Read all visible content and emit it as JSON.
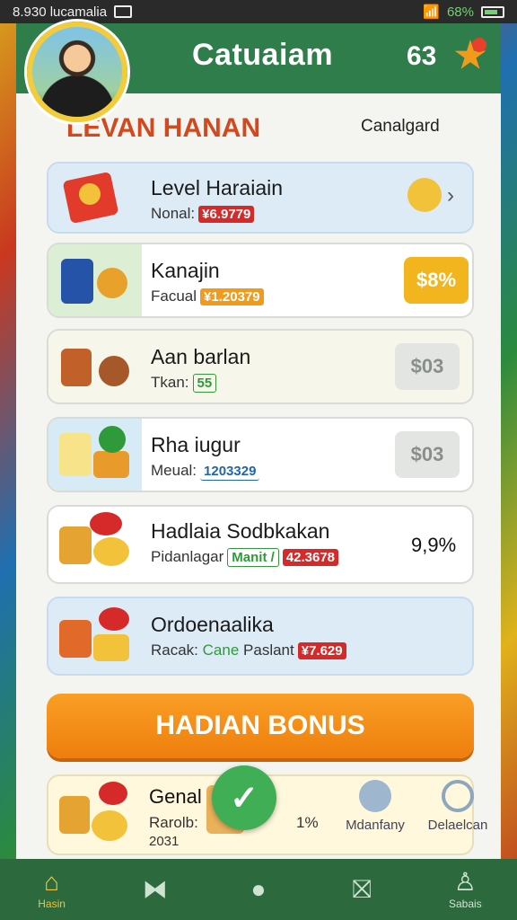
{
  "status_bar": {
    "time_text": "8.930 lucamalia",
    "battery": "68%"
  },
  "header": {
    "title": "Catuaiam",
    "count": "63"
  },
  "section": {
    "title": "LEVAN HANAN",
    "link": "Canalgard"
  },
  "items": [
    {
      "title": "Level Haraiain",
      "sub_label": "Nonal:",
      "tag": "¥6.9779",
      "action": "›"
    },
    {
      "title": "Kanajin",
      "sub_label": "Facual",
      "tag": "¥1.20379",
      "price": "$8%"
    },
    {
      "title": "Aan barlan",
      "sub_label": "Tkan:",
      "tag": "55",
      "price": "$03"
    },
    {
      "title": "Rha iugur",
      "sub_label": "Meual:",
      "tag": "1203329",
      "price": "$03"
    },
    {
      "title": "Hadlaia Sodbkakan",
      "sub_label": "Pidanlagar",
      "tag_green": "Manit /",
      "tag": "42.3678",
      "price": "9,9%"
    },
    {
      "title": "Ordoenaalika",
      "sub_label": "Racak:",
      "tag_green": "Cane",
      "sub_extra": "Paslant",
      "tag": "¥7.629"
    }
  ],
  "bonus_button": "HADIAN BONUS",
  "bottom_card": {
    "title": "Genal",
    "line2": "Rarolb:",
    "line3": "2031",
    "percent": "1%"
  },
  "side_items": [
    "Mdanfany",
    "Delaelcan"
  ],
  "nav": [
    {
      "label": "Hasin",
      "icon": "home-icon",
      "glyph": "⌂"
    },
    {
      "label": "",
      "icon": "ribbon-icon",
      "glyph": "⧓"
    },
    {
      "label": "",
      "icon": "circle-icon",
      "glyph": "●"
    },
    {
      "label": "",
      "icon": "bookmark-icon",
      "glyph": "⛝"
    },
    {
      "label": "Sabais",
      "icon": "profile-icon",
      "glyph": "♙"
    }
  ],
  "colors": {
    "primary": "#2f7d4a",
    "accent": "#f29a1b",
    "title_red": "#d2491f"
  }
}
